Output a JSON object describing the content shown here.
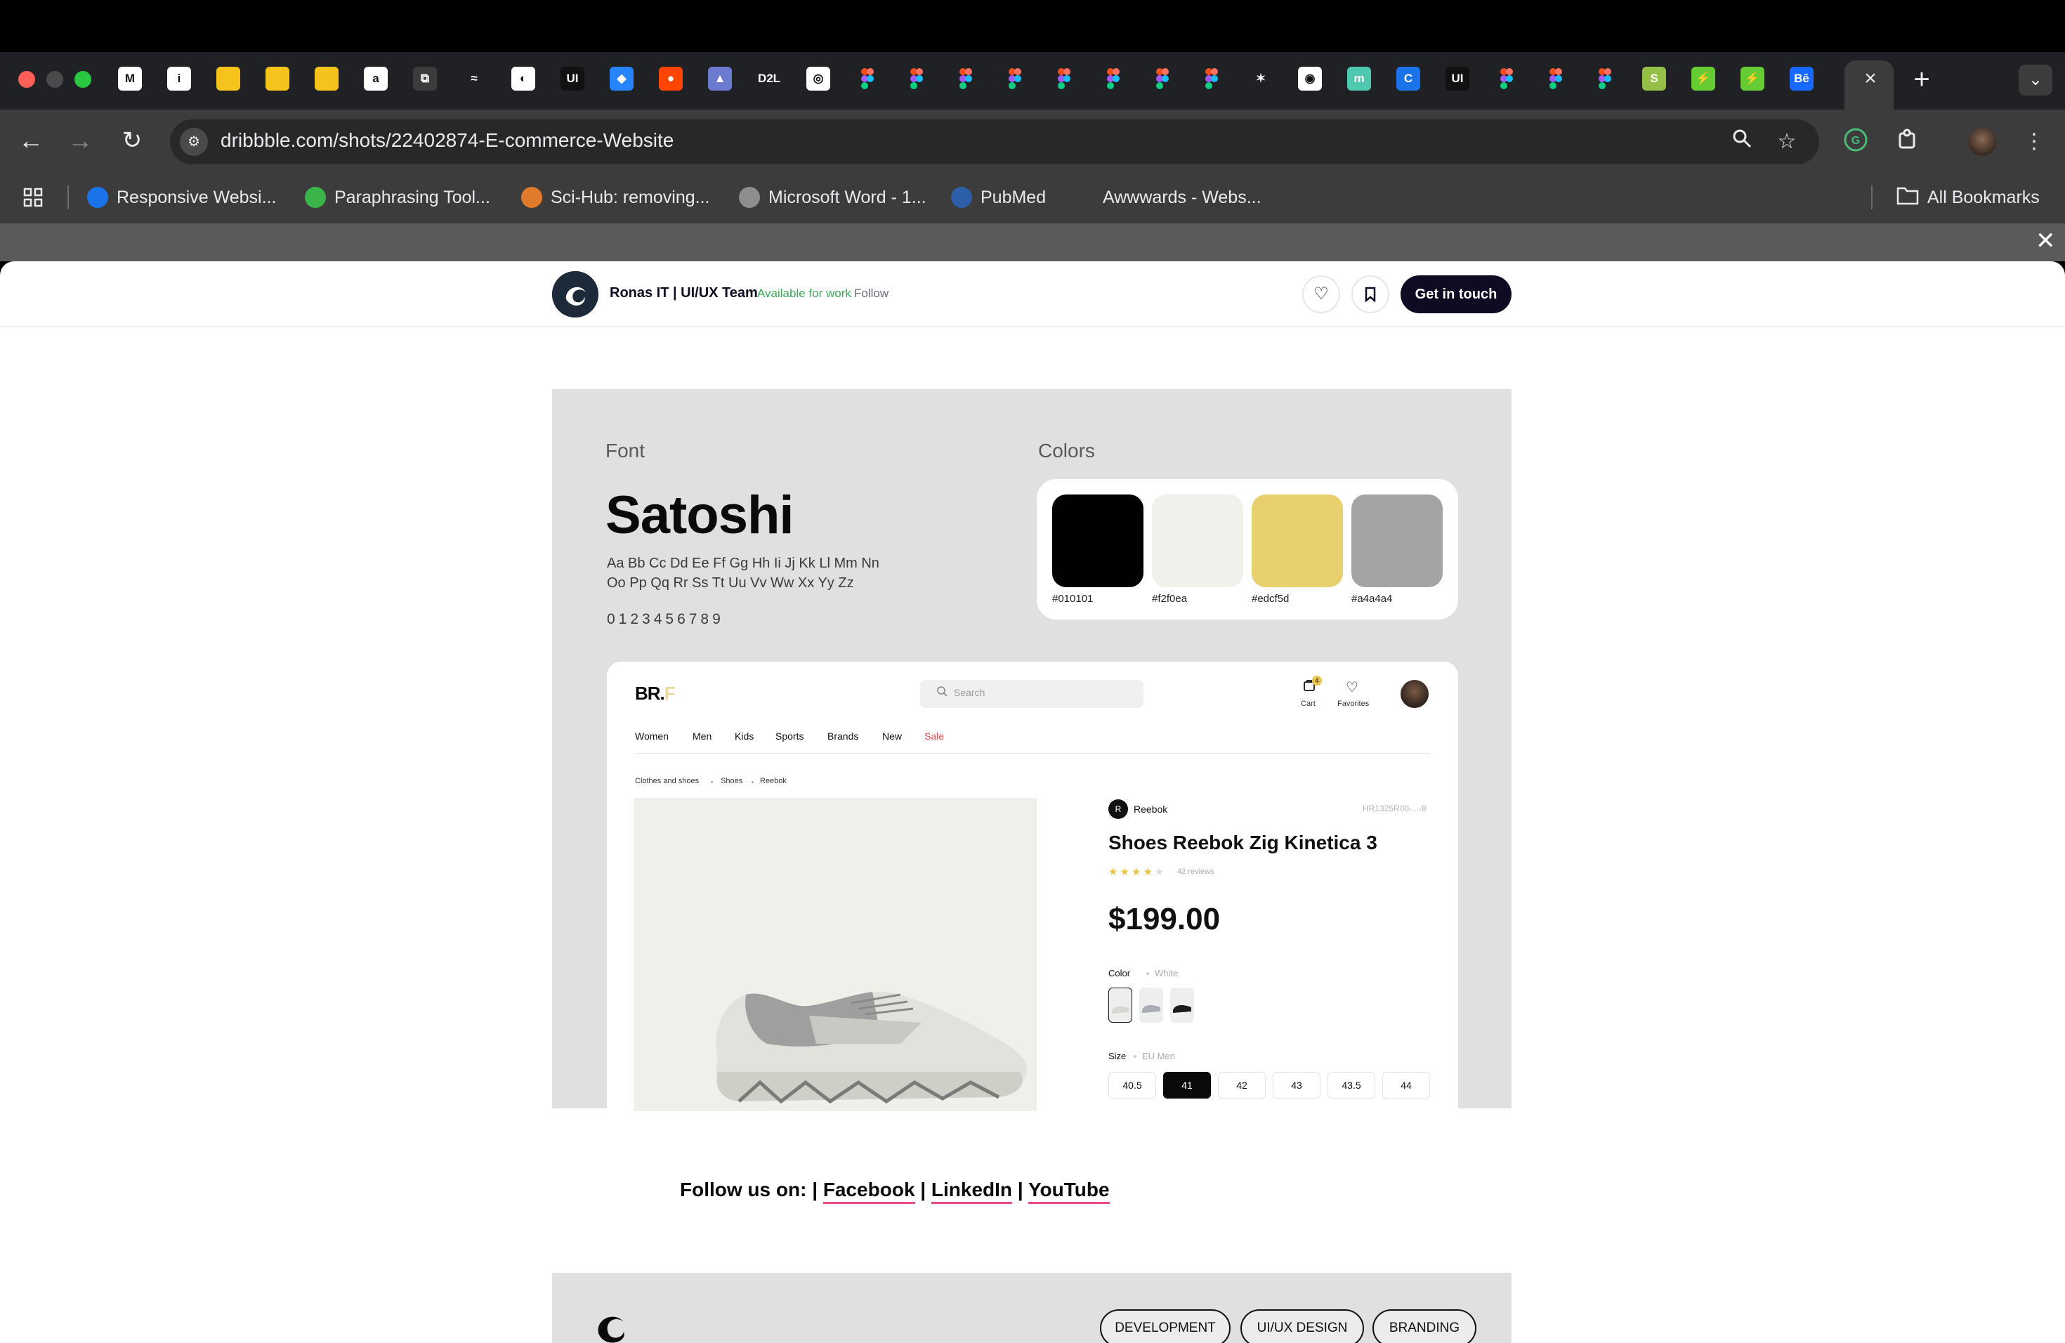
{
  "browser": {
    "url": "dribbble.com/shots/22402874-E-commerce-Website",
    "tab_close_label": "×",
    "new_tab_label": "+",
    "bookmarks": [
      {
        "label": "Responsive Websi...",
        "icon": "c-icon",
        "color": "#1a73e8"
      },
      {
        "label": "Paraphrasing Tool...",
        "icon": "robot-icon",
        "color": "#3bb54a"
      },
      {
        "label": "Sci-Hub: removing...",
        "icon": "sci-hub-icon",
        "color": "#e07b2b"
      },
      {
        "label": "Microsoft Word - 1...",
        "icon": "globe-icon",
        "color": "#8e8e8e"
      },
      {
        "label": "PubMed",
        "icon": "pubmed-icon",
        "color": "#2d5fa8"
      },
      {
        "label": "Awwwards - Webs...",
        "icon": "w-icon",
        "color": "#3c3c3c"
      }
    ],
    "all_bookmarks": "All Bookmarks"
  },
  "header": {
    "team": "Ronas IT | UI/UX Team",
    "availability": "Available for work",
    "follow": "Follow",
    "cta": "Get in touch"
  },
  "style_guide": {
    "font_heading": "Font",
    "font_name": "Satoshi",
    "alphabet_line1": "Aa Bb Cc Dd Ee Ff Gg Hh Ii Jj Kk Ll Mm Nn",
    "alphabet_line2": "Oo Pp Qq Rr Ss Tt Uu Vv Ww Xx Yy Zz",
    "digits": "0123456789",
    "colors_heading": "Colors",
    "swatches": [
      {
        "hex": "#010101",
        "color": "#010101"
      },
      {
        "hex": "#f2f0ea",
        "color": "#f2f0ea"
      },
      {
        "hex": "#edcf5d",
        "color": "#e9d06f"
      },
      {
        "hex": "#a4a4a4",
        "color": "#a4a4a4"
      }
    ]
  },
  "mockup": {
    "logo_main": "BR.",
    "logo_accent": "F",
    "search_placeholder": "Search",
    "cart_label": "Cart",
    "cart_count": "4",
    "favorites_label": "Favorites",
    "nav": [
      "Women",
      "Men",
      "Kids",
      "Sports",
      "Brands",
      "New",
      "Sale"
    ],
    "breadcrumbs": [
      "Clothes and shoes",
      "Shoes",
      "Reebok"
    ],
    "brand": "Reebok",
    "sku": "HR1325R00-...-8",
    "title": "Shoes Reebok Zig Kinetica 3",
    "rating": 4,
    "reviews": "42 reviews",
    "price": "$199.00",
    "color_label": "Color",
    "color_value": "White",
    "size_label": "Size",
    "size_value": "EU Men",
    "sizes": [
      "40.5",
      "41",
      "42",
      "43",
      "43.5",
      "44"
    ],
    "selected_size": "41"
  },
  "follow_section": {
    "prefix": "Follow us on: |",
    "links": [
      "Facebook",
      "LinkedIn",
      "YouTube"
    ],
    "sep": "|"
  },
  "footer": {
    "tags": [
      "DEVELOPMENT",
      "UI/UX DESIGN",
      "BRANDING"
    ]
  }
}
